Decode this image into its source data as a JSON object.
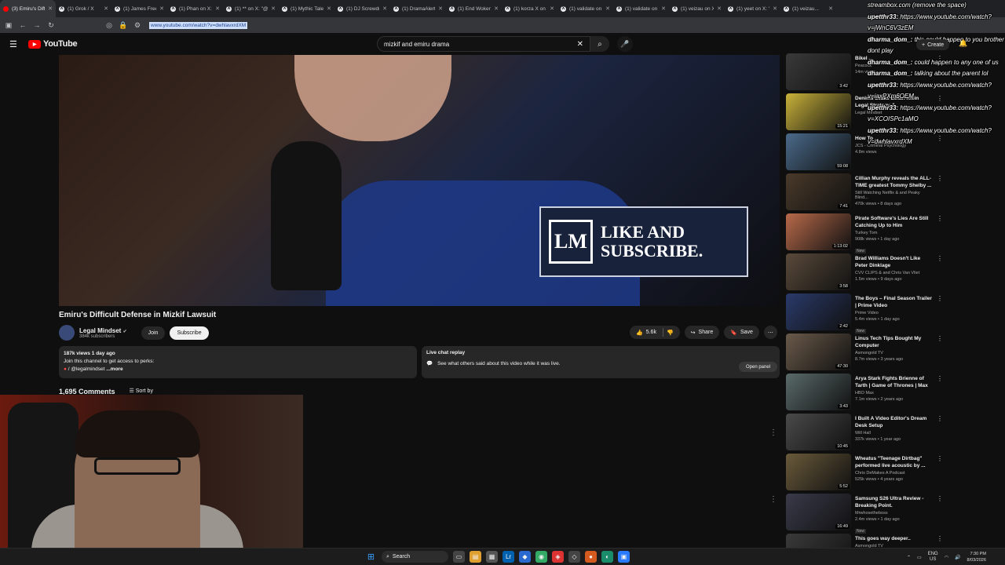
{
  "browser": {
    "tabs": [
      {
        "label": "(3) Emiru's Diffic...",
        "active": true
      },
      {
        "label": "(1) Grok / X"
      },
      {
        "label": "(1) James Freem..."
      },
      {
        "label": "(1) Phan on X: \"lis..."
      },
      {
        "label": "(1) ** on X: \"@c..."
      },
      {
        "label": "(1) Mythic Talent"
      },
      {
        "label": "(1) DJ Screwdriv..."
      },
      {
        "label": "(1) DramaAlert o..."
      },
      {
        "label": "(1) End Wokene..."
      },
      {
        "label": "(1) korza X on X..."
      },
      {
        "label": "(1) validate on X..."
      },
      {
        "label": "(1) validate on X..."
      },
      {
        "label": "(1) veizau on X: \"i..."
      },
      {
        "label": "(1) yeet on X: \"Ir..."
      },
      {
        "label": "(1) veizau..."
      }
    ],
    "url": "www.youtube.com/watch?v=dwhlavxrdXM"
  },
  "youtube": {
    "logo": "YouTube",
    "search_value": "mizkif and emiru drama",
    "create_label": "Create"
  },
  "video": {
    "overlay_logo": "LM",
    "overlay_line1": "LIKE AND",
    "overlay_line2": "SUBSCRIBE.",
    "title": "Emiru's Difficult Defense in Mizkif Lawsuit",
    "channel": "Legal Mindset",
    "subscribers": "384k subscribers",
    "join_label": "Join",
    "subscribe_label": "Subscribe",
    "likes": "5.6k",
    "share_label": "Share",
    "save_label": "Save",
    "views_date": "187k views  1 day ago",
    "desc_line": "Join this channel to get access to perks:",
    "desc_link": "/ @legalmindset",
    "more_label": "...more",
    "chat_title": "Live chat replay",
    "chat_sub": "See what others said about this video while it was live.",
    "open_panel": "Open panel",
    "comments_count": "1,695 Comments",
    "sort_label": "Sort by"
  },
  "recommendations": [
    {
      "title": "Bikel ...",
      "channel": "Peacock",
      "meta": "14m views",
      "duration": "3:42",
      "color": "#3a3a3a"
    },
    {
      "title": "Denims Leaks Ethan Klein Legal Strategy & Contradictions...",
      "channel": "Legal Mindset",
      "meta": "",
      "duration": "15:21",
      "color": "#c9b23a"
    },
    {
      "title": "How To ...",
      "channel": "JCS - Criminal Psychology",
      "meta": "4.8m views",
      "duration": "59:08",
      "color": "#4a6a8a"
    },
    {
      "title": "Cillian Murphy reveals the ALL-TIME greatest Tommy Shelby ...",
      "channel": "Still Watching Netflix & and Peaky Blind...",
      "meta": "470k views • 8 days ago",
      "duration": "7:41",
      "color": "#4a3a2a"
    },
    {
      "title": "Pirate Software's Lies Are Still Catching Up to Him",
      "channel": "Turkey Tom",
      "meta": "908k views • 1 day ago",
      "duration": "1:13:02",
      "color": "#b86a4a",
      "new": "New"
    },
    {
      "title": "Brad Williams Doesn't Like Peter Dinklage",
      "channel": "CVV CLIPS & and Chris Van Vliet",
      "meta": "1.5m views • 9 days ago",
      "duration": "3:58",
      "color": "#5a4a3a"
    },
    {
      "title": "The Boys – Final Season Trailer | Prime Video",
      "channel": "Prime Video",
      "meta": "5.4m views • 1 day ago",
      "duration": "2:42",
      "color": "#2a3a6a",
      "new": "New"
    },
    {
      "title": "Linus Tech Tips Bought My Computer",
      "channel": "Asmongold TV",
      "meta": "8.7m views • 3 years ago",
      "duration": "47:30",
      "color": "#6a5a4a"
    },
    {
      "title": "Arya Stark Fights Brienne of Tarth | Game of Thrones | Max",
      "channel": "HBO Max",
      "meta": "7.1m views • 2 years ago",
      "duration": "3:43",
      "color": "#5a6a6a"
    },
    {
      "title": "I Built A Video Editor's Dream Desk Setup",
      "channel": "Will Hall",
      "meta": "337k views • 1 year ago",
      "duration": "10:45",
      "color": "#4a4a4a"
    },
    {
      "title": "Wheatus \"Teenage Dirtbag\" performed live acoustic by ...",
      "channel": "Chris DeMakes A Podcast",
      "meta": "525k views • 4 years ago",
      "duration": "5:52",
      "color": "#6a5a3a"
    },
    {
      "title": "Samsung S26 Ultra Review - Breaking Point.",
      "channel": "Mrwhosetheboss",
      "meta": "2.4m views • 1 day ago",
      "duration": "16:49",
      "color": "#3a3a4a",
      "new": "New"
    },
    {
      "title": "This goes way deeper..",
      "channel": "Asmongold TV",
      "meta": "",
      "duration": "",
      "color": "#3a3a3a"
    }
  ],
  "chat_overlay": [
    {
      "user": "",
      "text": "streambox.com (remove the space)"
    },
    {
      "user": "upetthr33:",
      "text": "https://www.youtube.com/watch?v=jWnC6V3zEM"
    },
    {
      "user": "dharma_dom_:",
      "text": "this could happen to you brother dont play"
    },
    {
      "user": "dharma_dom_:",
      "text": "could happen to any one of us"
    },
    {
      "user": "dharma_dom_:",
      "text": "talking about the parent lol"
    },
    {
      "user": "upetthr33:",
      "text": "https://www.youtube.com/watch?v=iaxPXm6OEM"
    },
    {
      "user": "upetthr33:",
      "text": "https://www.youtube.com/watch?v=XCOISPc1aMO"
    },
    {
      "user": "upetthr33:",
      "text": "https://www.youtube.com/watch?v=dwhlavxrdXM"
    }
  ],
  "taskbar": {
    "search_label": "Search",
    "lang": "ENG",
    "region": "US",
    "time": "7:30 PM",
    "date": "8/03/2026"
  },
  "colors": {
    "accent": "#ff0000",
    "bg": "#0f0f0f"
  }
}
